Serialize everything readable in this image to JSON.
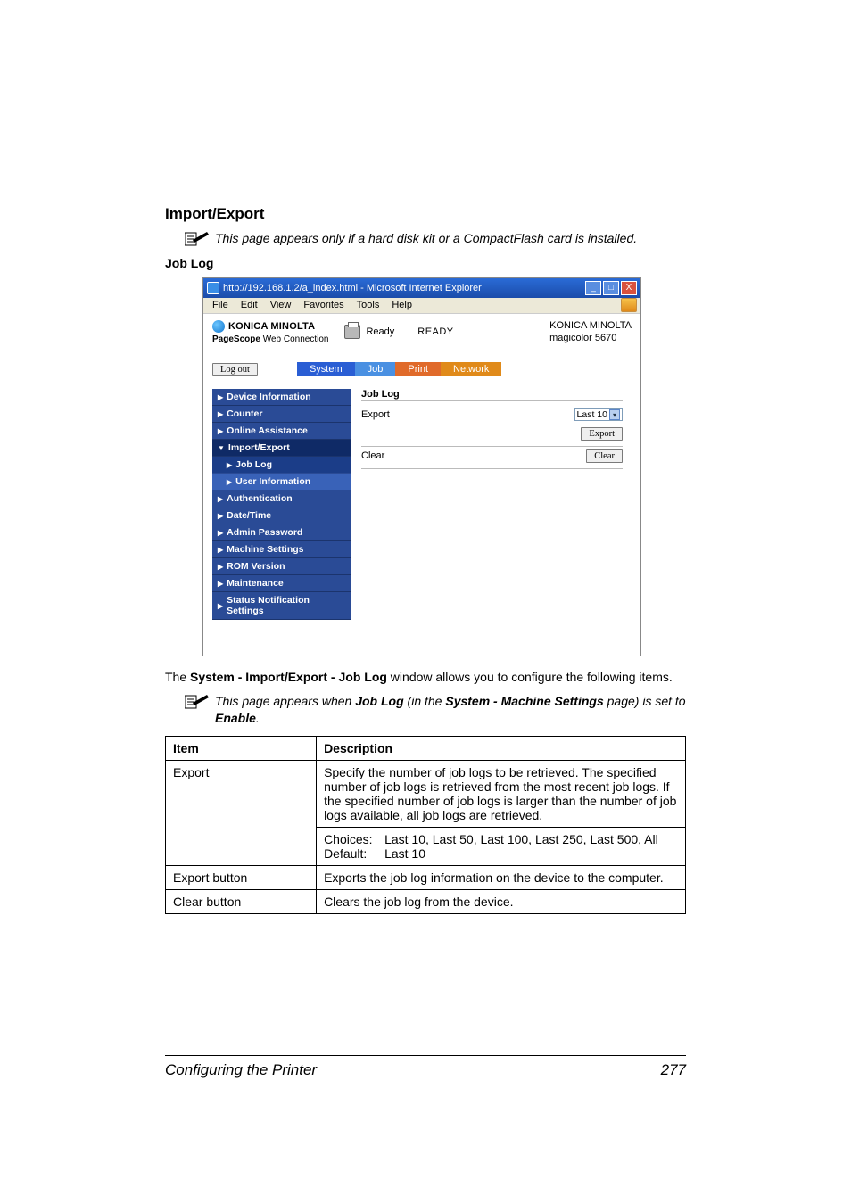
{
  "heading": "Import/Export",
  "note1": "This page appears only if a hard disk kit or a CompactFlash card is installed.",
  "subheading": "Job Log",
  "screenshot": {
    "title": "http://192.168.1.2/a_index.html - Microsoft Internet Explorer",
    "win_min": "_",
    "win_max": "□",
    "win_close": "X",
    "menu": {
      "file": "File",
      "edit": "Edit",
      "view": "View",
      "fav": "Favorites",
      "tools": "Tools",
      "help": "Help"
    },
    "brand": "KONICA MINOLTA",
    "pagescope_pre": "PageScope",
    "pagescope_rest": " Web Connection",
    "status_label": "Ready",
    "ready": "READY",
    "model_line1": "KONICA MINOLTA",
    "model_line2": "magicolor 5670",
    "logout": "Log out",
    "tabs": {
      "system": "System",
      "job": "Job",
      "print": "Print",
      "network": "Network"
    },
    "sidebar": {
      "device": "Device Information",
      "counter": "Counter",
      "online": "Online Assistance",
      "impexp": "Import/Export",
      "joblog": "Job Log",
      "userinfo": "User Information",
      "auth": "Authentication",
      "datetime": "Date/Time",
      "adminpw": "Admin Password",
      "machine": "Machine Settings",
      "rom": "ROM Version",
      "maint": "Maintenance",
      "status": "Status Notification Settings"
    },
    "main": {
      "title": "Job Log",
      "export_label": "Export",
      "select_value": "Last 10",
      "export_btn": "Export",
      "clear_label": "Clear",
      "clear_btn": "Clear"
    }
  },
  "body1_pre": "The ",
  "body1_bold": "System - Import/Export - Job Log",
  "body1_post": " window allows you to configure the following items.",
  "note2_pre": "This page appears when ",
  "note2_b1": "Job Log",
  "note2_mid": " (in the ",
  "note2_b2": "System - Machine Settings",
  "note2_mid2": " page) is set to ",
  "note2_b3": "Enable",
  "note2_post": ".",
  "table": {
    "h1": "Item",
    "h2": "Description",
    "r1c1": "Export",
    "r1c2": "Specify the number of job logs to be retrieved. The specified number of job logs is retrieved from the most recent job logs. If the specified number of job logs is larger than the number of job logs available, all job logs are retrieved.",
    "r1_choices_k": "Choices:",
    "r1_choices_v": "Last 10, Last 50, Last 100, Last 250, Last 500, All",
    "r1_default_k": "Default:",
    "r1_default_v": "Last 10",
    "r2c1": "Export button",
    "r2c2": "Exports the job log information on the device to the computer.",
    "r3c1": "Clear button",
    "r3c2": "Clears the job log from the device."
  },
  "footer_left": "Configuring the Printer",
  "footer_right": "277"
}
